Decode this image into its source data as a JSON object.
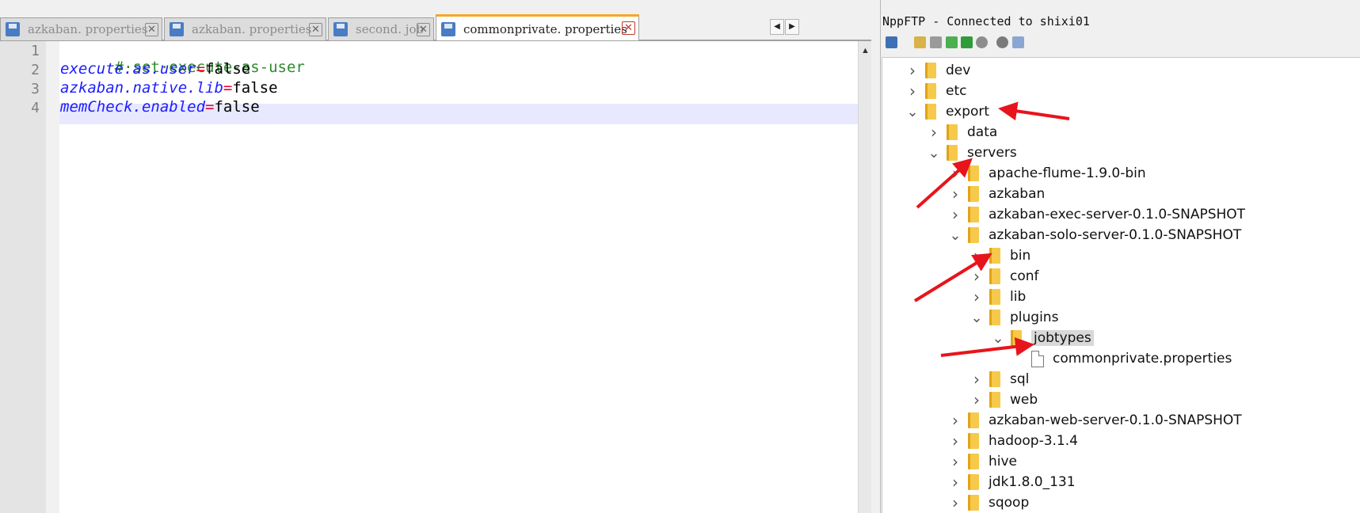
{
  "tabs": [
    {
      "label": "azkaban. properties",
      "active": false
    },
    {
      "label": "azkaban. properties",
      "active": false
    },
    {
      "label": "second. job",
      "active": false
    },
    {
      "label": "commonprivate. properties",
      "active": true
    }
  ],
  "tab_nav": {
    "prev": "◀",
    "next": "▶"
  },
  "editor": {
    "lines": [
      {
        "num": "1",
        "comment": "#·set·execute-as-user"
      },
      {
        "num": "2",
        "key": "execute.as.user",
        "op": "=",
        "value": "false"
      },
      {
        "num": "3",
        "key": "azkaban.native.lib",
        "op": "=",
        "value": "false"
      },
      {
        "num": "4",
        "key": "memCheck.enabled",
        "op": "=",
        "value": "false"
      }
    ]
  },
  "ftp": {
    "title": "NppFTP - Connected to shixi01",
    "tree": [
      {
        "name": "dev",
        "type": "folder",
        "depth": 0,
        "expanded": false
      },
      {
        "name": "etc",
        "type": "folder",
        "depth": 0,
        "expanded": false
      },
      {
        "name": "export",
        "type": "folder",
        "depth": 0,
        "expanded": true
      },
      {
        "name": "data",
        "type": "folder",
        "depth": 1,
        "expanded": false
      },
      {
        "name": "servers",
        "type": "folder",
        "depth": 1,
        "expanded": true
      },
      {
        "name": "apache-flume-1.9.0-bin",
        "type": "folder",
        "depth": 2,
        "expanded": false
      },
      {
        "name": "azkaban",
        "type": "folder",
        "depth": 2,
        "expanded": false
      },
      {
        "name": "azkaban-exec-server-0.1.0-SNAPSHOT",
        "type": "folder",
        "depth": 2,
        "expanded": false
      },
      {
        "name": "azkaban-solo-server-0.1.0-SNAPSHOT",
        "type": "folder",
        "depth": 2,
        "expanded": true
      },
      {
        "name": "bin",
        "type": "folder",
        "depth": 3,
        "expanded": false
      },
      {
        "name": "conf",
        "type": "folder",
        "depth": 3,
        "expanded": false
      },
      {
        "name": "lib",
        "type": "folder",
        "depth": 3,
        "expanded": false
      },
      {
        "name": "plugins",
        "type": "folder",
        "depth": 3,
        "expanded": true
      },
      {
        "name": "jobtypes",
        "type": "folder",
        "depth": 4,
        "expanded": true,
        "selected": true
      },
      {
        "name": "commonprivate.properties",
        "type": "file",
        "depth": 5
      },
      {
        "name": "sql",
        "type": "folder",
        "depth": 3,
        "expanded": false
      },
      {
        "name": "web",
        "type": "folder",
        "depth": 3,
        "expanded": false
      },
      {
        "name": "azkaban-web-server-0.1.0-SNAPSHOT",
        "type": "folder",
        "depth": 2,
        "expanded": false
      },
      {
        "name": "hadoop-3.1.4",
        "type": "folder",
        "depth": 2,
        "expanded": false
      },
      {
        "name": "hive",
        "type": "folder",
        "depth": 2,
        "expanded": false
      },
      {
        "name": "jdk1.8.0_131",
        "type": "folder",
        "depth": 2,
        "expanded": false
      },
      {
        "name": "sqoop",
        "type": "folder",
        "depth": 2,
        "expanded": false
      }
    ]
  },
  "colors": {
    "annotation_arrow": "#e8141c",
    "active_tab_accent": "#f5a623"
  }
}
